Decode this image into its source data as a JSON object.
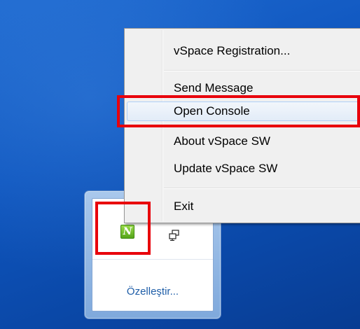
{
  "context_menu": {
    "items": [
      {
        "label": "vSpace Registration..."
      },
      {
        "label": "Send Message"
      },
      {
        "label": "Open Console"
      },
      {
        "label": "About vSpace SW"
      },
      {
        "label": "Update vSpace SW"
      },
      {
        "label": "Exit"
      }
    ],
    "highlighted_item": "Open Console"
  },
  "tray_flyout": {
    "vspace_icon_letter": "N",
    "vspace_icon": "vspace-n-icon",
    "network_icon": "network-icon",
    "customize_link": "Özelleştir..."
  },
  "colors": {
    "desktop_blue": "#0f56bf",
    "annotation_red": "#e8000b",
    "vspace_icon_green": "#54a41a",
    "link_blue": "#1f5ea8"
  }
}
